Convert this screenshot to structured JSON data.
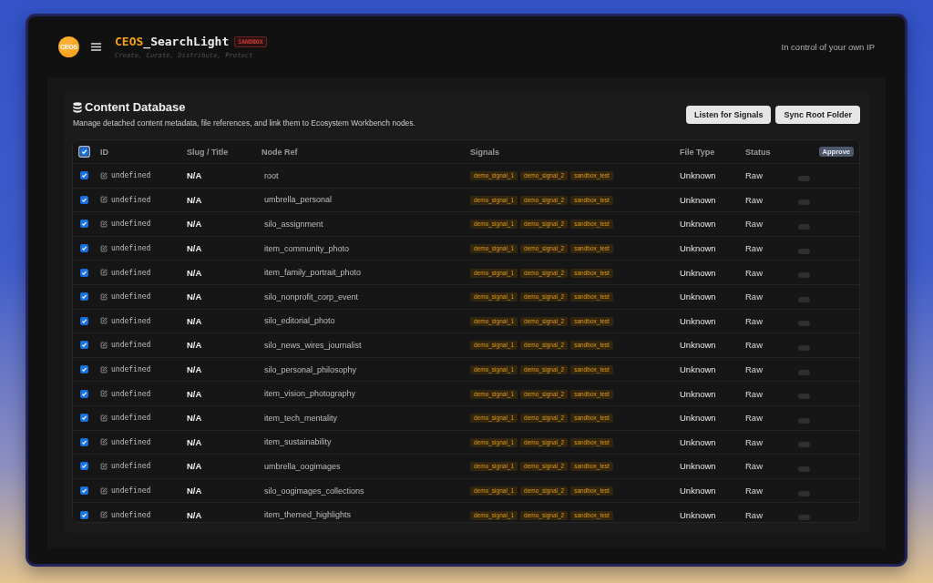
{
  "header": {
    "logo_text": "CEOS",
    "brand_accent": "CEOS",
    "brand_rest": "_SearchLight",
    "env_badge": "SANDBOX",
    "tagline": "Create, Curate, Distribute, Protect",
    "motto": "In control of your own IP"
  },
  "panel": {
    "title": "Content Database",
    "description": "Manage detached content metadata, file references, and link them to Ecosystem Workbench nodes.",
    "buttons": [
      {
        "label": "Listen for Signals"
      },
      {
        "label": "Sync Root Folder"
      }
    ]
  },
  "table": {
    "select_all": {
      "checked": true
    },
    "columns": [
      {
        "label": "ID",
        "kind": "text"
      },
      {
        "label": "Slug / Title",
        "kind": "text"
      },
      {
        "label": "Node Ref",
        "kind": "text"
      },
      {
        "label": "Signals",
        "kind": "text"
      },
      {
        "label": "File Type",
        "kind": "text"
      },
      {
        "label": "Status",
        "kind": "text"
      },
      {
        "label": "Approve",
        "kind": "button"
      }
    ],
    "rows": [
      {
        "checked": true,
        "id": "undefined",
        "slug": "N/A",
        "node_ref": "root",
        "signals": [
          "demo_signal_1",
          "demo_signal_2",
          "sandbox_test"
        ],
        "file_type": "Unknown",
        "status": "Raw",
        "approved": false
      },
      {
        "checked": true,
        "id": "undefined",
        "slug": "N/A",
        "node_ref": "umbrella_personal",
        "signals": [
          "demo_signal_1",
          "demo_signal_2",
          "sandbox_test"
        ],
        "file_type": "Unknown",
        "status": "Raw",
        "approved": false
      },
      {
        "checked": true,
        "id": "undefined",
        "slug": "N/A",
        "node_ref": "silo_assignment",
        "signals": [
          "demo_signal_1",
          "demo_signal_2",
          "sandbox_test"
        ],
        "file_type": "Unknown",
        "status": "Raw",
        "approved": false
      },
      {
        "checked": true,
        "id": "undefined",
        "slug": "N/A",
        "node_ref": "item_community_photo",
        "signals": [
          "demo_signal_1",
          "demo_signal_2",
          "sandbox_test"
        ],
        "file_type": "Unknown",
        "status": "Raw",
        "approved": false
      },
      {
        "checked": true,
        "id": "undefined",
        "slug": "N/A",
        "node_ref": "item_family_portrait_photo",
        "signals": [
          "demo_signal_1",
          "demo_signal_2",
          "sandbox_test"
        ],
        "file_type": "Unknown",
        "status": "Raw",
        "approved": false
      },
      {
        "checked": true,
        "id": "undefined",
        "slug": "N/A",
        "node_ref": "silo_nonprofit_corp_event",
        "signals": [
          "demo_signal_1",
          "demo_signal_2",
          "sandbox_test"
        ],
        "file_type": "Unknown",
        "status": "Raw",
        "approved": false
      },
      {
        "checked": true,
        "id": "undefined",
        "slug": "N/A",
        "node_ref": "silo_editorial_photo",
        "signals": [
          "demo_signal_1",
          "demo_signal_2",
          "sandbox_test"
        ],
        "file_type": "Unknown",
        "status": "Raw",
        "approved": false
      },
      {
        "checked": true,
        "id": "undefined",
        "slug": "N/A",
        "node_ref": "silo_news_wires_journalist",
        "signals": [
          "demo_signal_1",
          "demo_signal_2",
          "sandbox_test"
        ],
        "file_type": "Unknown",
        "status": "Raw",
        "approved": false
      },
      {
        "checked": true,
        "id": "undefined",
        "slug": "N/A",
        "node_ref": "silo_personal_philosophy",
        "signals": [
          "demo_signal_1",
          "demo_signal_2",
          "sandbox_test"
        ],
        "file_type": "Unknown",
        "status": "Raw",
        "approved": false
      },
      {
        "checked": true,
        "id": "undefined",
        "slug": "N/A",
        "node_ref": "item_vision_photography",
        "signals": [
          "demo_signal_1",
          "demo_signal_2",
          "sandbox_test"
        ],
        "file_type": "Unknown",
        "status": "Raw",
        "approved": false
      },
      {
        "checked": true,
        "id": "undefined",
        "slug": "N/A",
        "node_ref": "item_tech_mentality",
        "signals": [
          "demo_signal_1",
          "demo_signal_2",
          "sandbox_test"
        ],
        "file_type": "Unknown",
        "status": "Raw",
        "approved": false
      },
      {
        "checked": true,
        "id": "undefined",
        "slug": "N/A",
        "node_ref": "item_sustainability",
        "signals": [
          "demo_signal_1",
          "demo_signal_2",
          "sandbox_test"
        ],
        "file_type": "Unknown",
        "status": "Raw",
        "approved": false
      },
      {
        "checked": true,
        "id": "undefined",
        "slug": "N/A",
        "node_ref": "umbrella_oogimages",
        "signals": [
          "demo_signal_1",
          "demo_signal_2",
          "sandbox_test"
        ],
        "file_type": "Unknown",
        "status": "Raw",
        "approved": false
      },
      {
        "checked": true,
        "id": "undefined",
        "slug": "N/A",
        "node_ref": "silo_oogimages_collections",
        "signals": [
          "demo_signal_1",
          "demo_signal_2",
          "sandbox_test"
        ],
        "file_type": "Unknown",
        "status": "Raw",
        "approved": false
      },
      {
        "checked": true,
        "id": "undefined",
        "slug": "N/A",
        "node_ref": "item_themed_highlights",
        "signals": [
          "demo_signal_1",
          "demo_signal_2",
          "sandbox_test"
        ],
        "file_type": "Unknown",
        "status": "Raw",
        "approved": false
      }
    ]
  }
}
